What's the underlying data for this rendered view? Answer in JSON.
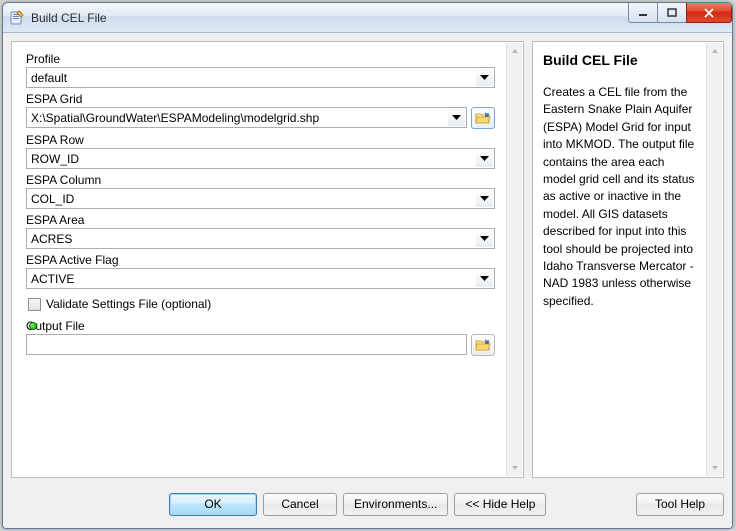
{
  "window": {
    "title": "Build CEL File"
  },
  "form": {
    "profile": {
      "label": "Profile",
      "value": "default"
    },
    "grid": {
      "label": "ESPA Grid",
      "value": "X:\\Spatial\\GroundWater\\ESPAModeling\\modelgrid.shp"
    },
    "row": {
      "label": "ESPA Row",
      "value": "ROW_ID"
    },
    "column": {
      "label": "ESPA Column",
      "value": "COL_ID"
    },
    "area": {
      "label": "ESPA Area",
      "value": "ACRES"
    },
    "active": {
      "label": "ESPA Active Flag",
      "value": "ACTIVE"
    },
    "validate": {
      "label": "Validate Settings File (optional)"
    },
    "output": {
      "label": "Output File",
      "value": ""
    }
  },
  "help": {
    "title": "Build CEL File",
    "body": "Creates a CEL file from the Eastern Snake Plain Aquifer (ESPA) Model Grid for input into MKMOD. The output file contains the area each model grid cell and its status as active or inactive in the model. All GIS datasets described for input into this tool should be projected into Idaho Transverse Mercator - NAD 1983 unless otherwise specified."
  },
  "buttons": {
    "ok": "OK",
    "cancel": "Cancel",
    "env": "Environments...",
    "hidehelp": "<< Hide Help",
    "toolhelp": "Tool Help"
  }
}
